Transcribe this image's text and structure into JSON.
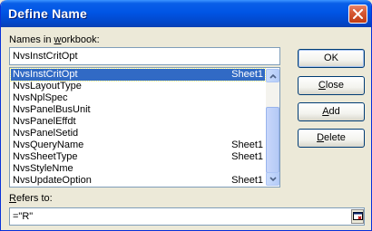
{
  "window": {
    "title": "Define Name"
  },
  "names_label": {
    "before": "Names in ",
    "accel": "w",
    "after": "orkbook:"
  },
  "names_input": {
    "value": "NvsInstCritOpt"
  },
  "names_list": [
    {
      "name": "NvsInstCritOpt",
      "sheet": "Sheet1",
      "selected": true
    },
    {
      "name": "NvsLayoutType",
      "sheet": ""
    },
    {
      "name": "NvsNplSpec",
      "sheet": ""
    },
    {
      "name": "NvsPanelBusUnit",
      "sheet": ""
    },
    {
      "name": "NvsPanelEffdt",
      "sheet": ""
    },
    {
      "name": "NvsPanelSetid",
      "sheet": ""
    },
    {
      "name": "NvsQueryName",
      "sheet": "Sheet1"
    },
    {
      "name": "NvsSheetType",
      "sheet": "Sheet1"
    },
    {
      "name": "NvsStyleNme",
      "sheet": ""
    },
    {
      "name": "NvsUpdateOption",
      "sheet": "Sheet1"
    }
  ],
  "buttons": {
    "ok": "OK",
    "close": {
      "accel": "C",
      "rest": "lose"
    },
    "add": {
      "accel": "A",
      "rest": "dd"
    },
    "delete": {
      "accel": "D",
      "rest": "elete"
    }
  },
  "refers_label": {
    "accel": "R",
    "after": "efers to:"
  },
  "refers_input": {
    "value": "=\"R\""
  },
  "icons": {
    "close": "close-x-icon",
    "collapse": "collapse-dialog-icon",
    "scroll_up": "arrow-up-icon",
    "scroll_down": "arrow-down-icon"
  },
  "colors": {
    "titlebar": "#0055E5",
    "selection": "#316AC5",
    "dialog_bg": "#ECE9D8"
  }
}
